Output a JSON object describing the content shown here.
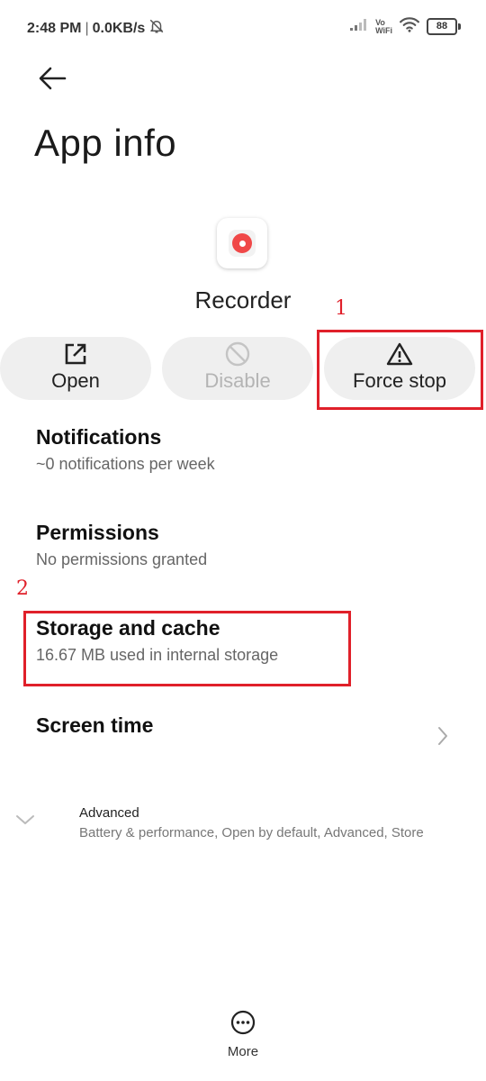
{
  "status_bar": {
    "time": "2:48 PM",
    "speed": "0.0KB/s",
    "separator": "|",
    "vowifi_top": "Vo",
    "vowifi_bottom": "WiFi",
    "battery": "88"
  },
  "header": {
    "title": "App info"
  },
  "app": {
    "name": "Recorder",
    "icon": "recorder-icon",
    "accent": "#f04848"
  },
  "actions": {
    "open_label": "Open",
    "disable_label": "Disable",
    "force_stop_label": "Force stop"
  },
  "annotations": {
    "marker_1": "1",
    "marker_2": "2",
    "color": "#e0202a"
  },
  "settings": {
    "notifications": {
      "title": "Notifications",
      "subtitle": "~0 notifications per week"
    },
    "permissions": {
      "title": "Permissions",
      "subtitle": "No permissions granted"
    },
    "storage": {
      "title": "Storage and cache",
      "subtitle": "16.67 MB used in internal storage"
    },
    "screen_time": {
      "title": "Screen time"
    },
    "advanced": {
      "title": "Advanced",
      "subtitle": "Battery & performance, Open by default, Advanced, Store"
    }
  },
  "footer": {
    "more_label": "More"
  }
}
